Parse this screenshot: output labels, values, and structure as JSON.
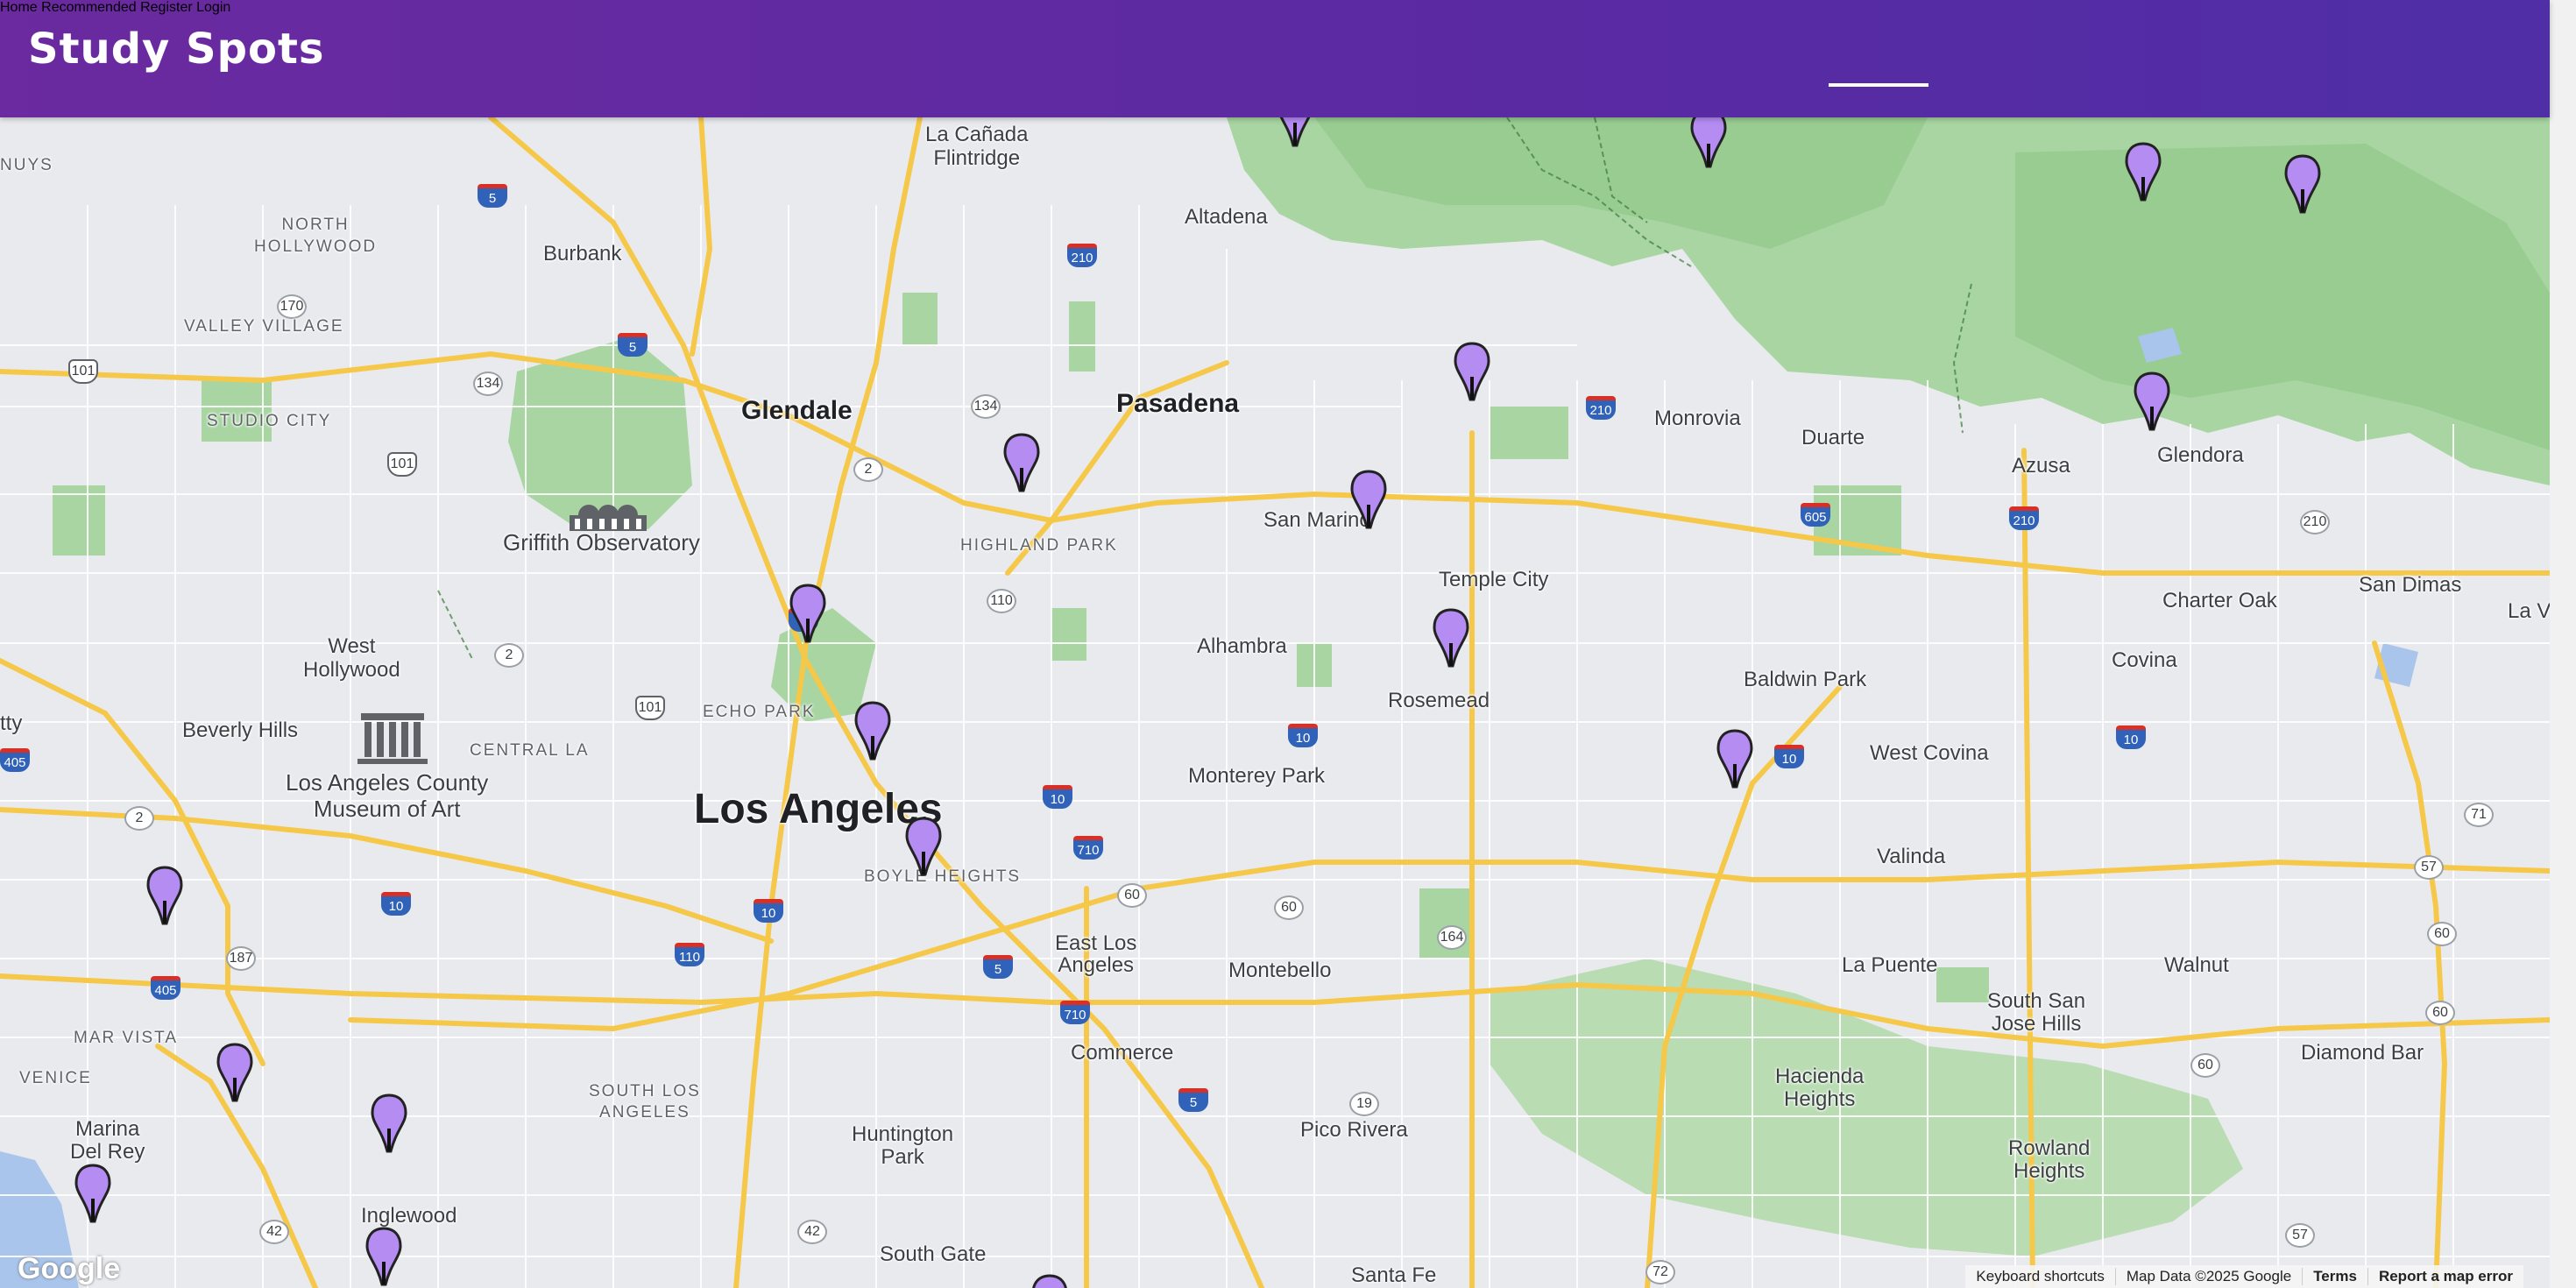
{
  "brand": "Study Spots",
  "nav": [
    {
      "label": "Home",
      "active": true
    },
    {
      "label": "Recommended",
      "active": false
    },
    {
      "label": "Register",
      "active": false
    },
    {
      "label": "Login",
      "active": false
    }
  ],
  "map": {
    "labels": {
      "la_canada": "La Cañada\nFlintridge",
      "altadena": "Altadena",
      "burbank": "Burbank",
      "north_hollywood": "NORTH\nHOLLYWOOD",
      "valley_village": "VALLEY VILLAGE",
      "studio_city": "STUDIO CITY",
      "glendale": "Glendale",
      "pasadena": "Pasadena",
      "monrovia": "Monrovia",
      "duarte": "Duarte",
      "azusa": "Azusa",
      "glendora": "Glendora",
      "san_marino": "San Marino",
      "highland_park": "HIGHLAND PARK",
      "temple_city": "Temple City",
      "griffith": "Griffith Observatory",
      "west_hollywood": "West\nHollywood",
      "beverly_hills": "Beverly Hills",
      "alhambra": "Alhambra",
      "echo_park": "ECHO PARK",
      "central_la": "CENTRAL LA",
      "lacma": "Los Angeles County\nMuseum of Art",
      "los_angeles": "Los Angeles",
      "rosemead": "Rosemead",
      "monterey_park": "Monterey Park",
      "baldwin_park": "Baldwin Park",
      "west_covina": "West Covina",
      "covina": "Covina",
      "charter_oak": "Charter Oak",
      "san_dimas": "San Dimas",
      "la_verne": "La V",
      "boyle_heights": "BOYLE HEIGHTS",
      "east_la": "East Los\nAngeles",
      "montebello": "Montebello",
      "valinda": "Valinda",
      "la_puente": "La Puente",
      "walnut": "Walnut",
      "south_san_jose": "South San\nJose Hills",
      "diamond_bar": "Diamond Bar",
      "commerce": "Commerce",
      "mar_vista": "MAR VISTA",
      "venice": "VENICE",
      "marina_del_rey": "Marina\nDel Rey",
      "south_la": "SOUTH LOS\nANGELES",
      "hacienda_heights": "Hacienda\nHeights",
      "rowland_heights": "Rowland\nHeights",
      "pico_rivera": "Pico Rivera",
      "huntington_park": "Huntington\nPark",
      "inglewood": "Inglewood",
      "south_gate": "South Gate",
      "santa_fe": "Santa Fe",
      "nuys": "NUYS",
      "tty": "tty"
    },
    "footer": {
      "shortcuts": "Keyboard shortcuts",
      "map_data": "Map Data ©2025 Google",
      "terms": "Terms",
      "report": "Report a map error"
    },
    "google_logo": "Google",
    "marker_color": "#b48cf2",
    "marker_count": 22
  }
}
